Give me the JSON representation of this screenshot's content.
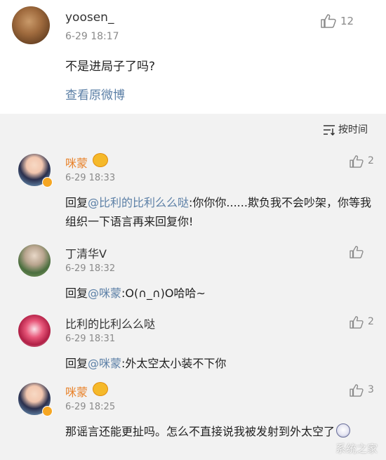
{
  "post": {
    "username": "yoosen_",
    "time": "6-29 18:17",
    "like_count": "12",
    "text": "不是进局子了吗?",
    "view_original": "查看原微博"
  },
  "sort": {
    "label": "按时间"
  },
  "comments": [
    {
      "username": "咪蒙",
      "time": "6-29 18:33",
      "like_count": "2",
      "reply_prefix": "回复",
      "mention": "@比利的比利么么哒",
      "text": ":你你你......欺负我不会吵架，你等我组织一下语言再来回复你!"
    },
    {
      "username": "丁清华V",
      "time": "6-29 18:32",
      "like_count": "",
      "reply_prefix": "回复",
      "mention": "@咪蒙",
      "text": ":O(∩_∩)O哈哈~"
    },
    {
      "username": "比利的比利么么哒",
      "time": "6-29 18:31",
      "like_count": "2",
      "reply_prefix": "回复",
      "mention": "@咪蒙",
      "text": ":外太空太小装不下你"
    },
    {
      "username": "咪蒙",
      "time": "6-29 18:25",
      "like_count": "3",
      "text": "那谣言还能更扯吗。怎么不直接说我被发射到外太空了"
    }
  ],
  "watermark": "系统之家",
  "colors": {
    "link": "#5b7fa6",
    "muted": "#8a8a8a",
    "section_bg": "#f2f2f2"
  }
}
